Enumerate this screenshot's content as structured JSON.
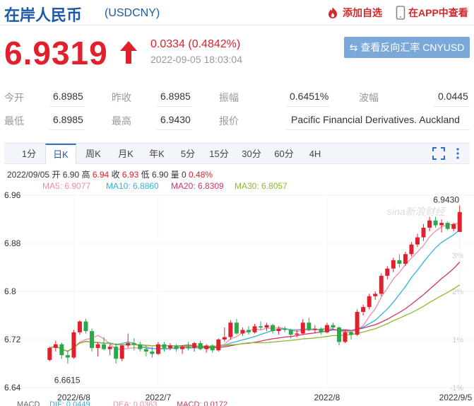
{
  "header": {
    "title": "在岸人民币",
    "code": "(USDCNY)",
    "add_favorite": "添加自选",
    "app_view": "在APP中查看"
  },
  "quote": {
    "price": "6.9319",
    "change": "0.0334 (0.4842%)",
    "time": "2022-09-05 18:03:04",
    "reverse_button": "查看反向汇率 CNYUSD"
  },
  "stats": {
    "row1": [
      {
        "label": "今开",
        "value": "6.8985"
      },
      {
        "label": "昨收",
        "value": "6.8985"
      },
      {
        "label": "振幅",
        "value": "0.6451%"
      },
      {
        "label": "波幅",
        "value": "0.0445"
      }
    ],
    "row2": [
      {
        "label": "最低",
        "value": "6.8985"
      },
      {
        "label": "最高",
        "value": "6.9430"
      },
      {
        "label": "报价",
        "value": "Pacific Financial Derivatives. Auckland"
      }
    ]
  },
  "tabs": [
    "1分",
    "日K",
    "周K",
    "月K",
    "年K",
    "5分",
    "15分",
    "30分",
    "60分",
    "4H"
  ],
  "active_tab": "日K",
  "info": {
    "date": "2022/09/05",
    "open_label": "开",
    "open": "6.90",
    "high_label": "高",
    "high": "6.94",
    "close_label": "收",
    "close": "6.93",
    "low_label": "低",
    "low": "6.90",
    "vol_label": "量",
    "vol": "0",
    "pct": "0.48%"
  },
  "ma": [
    {
      "label": "MA5: 6.9077",
      "color": "#f08ca8"
    },
    {
      "label": "MA10: 6.8860",
      "color": "#2fb3d9"
    },
    {
      "label": "MA20: 6.8309",
      "color": "#d6336c"
    },
    {
      "label": "MA30: 6.8057",
      "color": "#8dba2c"
    }
  ],
  "macd": [
    {
      "label": "MACD",
      "color": "#666"
    },
    {
      "label": "DIF: 0.0449",
      "color": "#2fb3d9"
    },
    {
      "label": "DEA: 0.0363",
      "color": "#f08ca8"
    },
    {
      "label": "MACD: 0.0172",
      "color": "#d6336c"
    }
  ],
  "chart_data": {
    "type": "candlestick",
    "y_ticks": [
      "6.96",
      "6.88",
      "6.8",
      "6.72",
      "6.64"
    ],
    "x_ticks": [
      "2022/6/8",
      "2022/7",
      "2022/8",
      "2022/9/5"
    ],
    "right_ticks": [
      "3%",
      "2%",
      "1%",
      "-1%"
    ],
    "ylim": [
      6.64,
      6.96
    ],
    "max_label": "6.9430",
    "min_label": "6.6615",
    "watermark": "sina新浪财经",
    "colors": {
      "up": "#e0202c",
      "down": "#2aa84a"
    },
    "candles": [
      [
        6.686,
        6.708,
        6.684,
        6.706
      ],
      [
        6.706,
        6.718,
        6.7,
        6.712
      ],
      [
        6.712,
        6.715,
        6.688,
        6.694
      ],
      [
        6.694,
        6.702,
        6.68,
        6.69
      ],
      [
        6.69,
        6.736,
        6.688,
        6.732
      ],
      [
        6.732,
        6.752,
        6.728,
        6.75
      ],
      [
        6.75,
        6.754,
        6.73,
        6.734
      ],
      [
        6.734,
        6.738,
        6.7,
        6.706
      ],
      [
        6.706,
        6.716,
        6.692,
        6.712
      ],
      [
        6.712,
        6.724,
        6.702,
        6.704
      ],
      [
        6.704,
        6.712,
        6.694,
        6.708
      ],
      [
        6.708,
        6.714,
        6.68,
        6.688
      ],
      [
        6.688,
        6.712,
        6.684,
        6.71
      ],
      [
        6.71,
        6.73,
        6.706,
        6.714
      ],
      [
        6.714,
        6.722,
        6.702,
        6.712
      ],
      [
        6.712,
        6.716,
        6.7,
        6.704
      ],
      [
        6.704,
        6.71,
        6.692,
        6.7
      ],
      [
        6.7,
        6.708,
        6.69,
        6.696
      ],
      [
        6.696,
        6.716,
        6.694,
        6.712
      ],
      [
        6.712,
        6.716,
        6.7,
        6.706
      ],
      [
        6.706,
        6.714,
        6.702,
        6.71
      ],
      [
        6.71,
        6.712,
        6.7,
        6.704
      ],
      [
        6.704,
        6.71,
        6.696,
        6.708
      ],
      [
        6.708,
        6.716,
        6.702,
        6.706
      ],
      [
        6.706,
        6.716,
        6.7,
        6.714
      ],
      [
        6.714,
        6.718,
        6.702,
        6.704
      ],
      [
        6.704,
        6.712,
        6.698,
        6.71
      ],
      [
        6.71,
        6.712,
        6.698,
        6.702
      ],
      [
        6.702,
        6.722,
        6.7,
        6.72
      ],
      [
        6.72,
        6.74,
        6.716,
        6.724
      ],
      [
        6.724,
        6.752,
        6.72,
        6.748
      ],
      [
        6.748,
        6.754,
        6.728,
        6.73
      ],
      [
        6.73,
        6.74,
        6.726,
        6.736
      ],
      [
        6.736,
        6.742,
        6.728,
        6.732
      ],
      [
        6.732,
        6.746,
        6.73,
        6.742
      ],
      [
        6.742,
        6.75,
        6.736,
        6.74
      ],
      [
        6.74,
        6.748,
        6.734,
        6.744
      ],
      [
        6.744,
        6.746,
        6.73,
        6.734
      ],
      [
        6.734,
        6.742,
        6.728,
        6.738
      ],
      [
        6.738,
        6.742,
        6.732,
        6.736
      ],
      [
        6.736,
        6.738,
        6.722,
        6.728
      ],
      [
        6.728,
        6.736,
        6.724,
        6.73
      ],
      [
        6.73,
        6.754,
        6.728,
        6.748
      ],
      [
        6.748,
        6.756,
        6.734,
        6.736
      ],
      [
        6.736,
        6.744,
        6.73,
        6.738
      ],
      [
        6.738,
        6.74,
        6.728,
        6.732
      ],
      [
        6.732,
        6.748,
        6.73,
        6.744
      ],
      [
        6.744,
        6.748,
        6.736,
        6.74
      ],
      [
        6.74,
        6.742,
        6.71,
        6.716
      ],
      [
        6.716,
        6.736,
        6.714,
        6.732
      ],
      [
        6.732,
        6.736,
        6.72,
        6.728
      ],
      [
        6.728,
        6.77,
        6.726,
        6.766
      ],
      [
        6.766,
        6.778,
        6.76,
        6.774
      ],
      [
        6.774,
        6.796,
        6.77,
        6.792
      ],
      [
        6.792,
        6.8,
        6.786,
        6.796
      ],
      [
        6.796,
        6.83,
        6.792,
        6.826
      ],
      [
        6.826,
        6.842,
        6.82,
        6.838
      ],
      [
        6.838,
        6.856,
        6.832,
        6.852
      ],
      [
        6.852,
        6.862,
        6.84,
        6.846
      ],
      [
        6.846,
        6.866,
        6.842,
        6.862
      ],
      [
        6.862,
        6.882,
        6.858,
        6.878
      ],
      [
        6.878,
        6.896,
        6.874,
        6.89
      ],
      [
        6.89,
        6.912,
        6.884,
        6.906
      ],
      [
        6.906,
        6.924,
        6.9,
        6.918
      ],
      [
        6.918,
        6.924,
        6.906,
        6.91
      ],
      [
        6.91,
        6.92,
        6.898,
        6.914
      ],
      [
        6.914,
        6.916,
        6.902,
        6.904
      ],
      [
        6.904,
        6.914,
        6.9,
        6.912
      ],
      [
        6.899,
        6.943,
        6.899,
        6.932
      ]
    ]
  }
}
